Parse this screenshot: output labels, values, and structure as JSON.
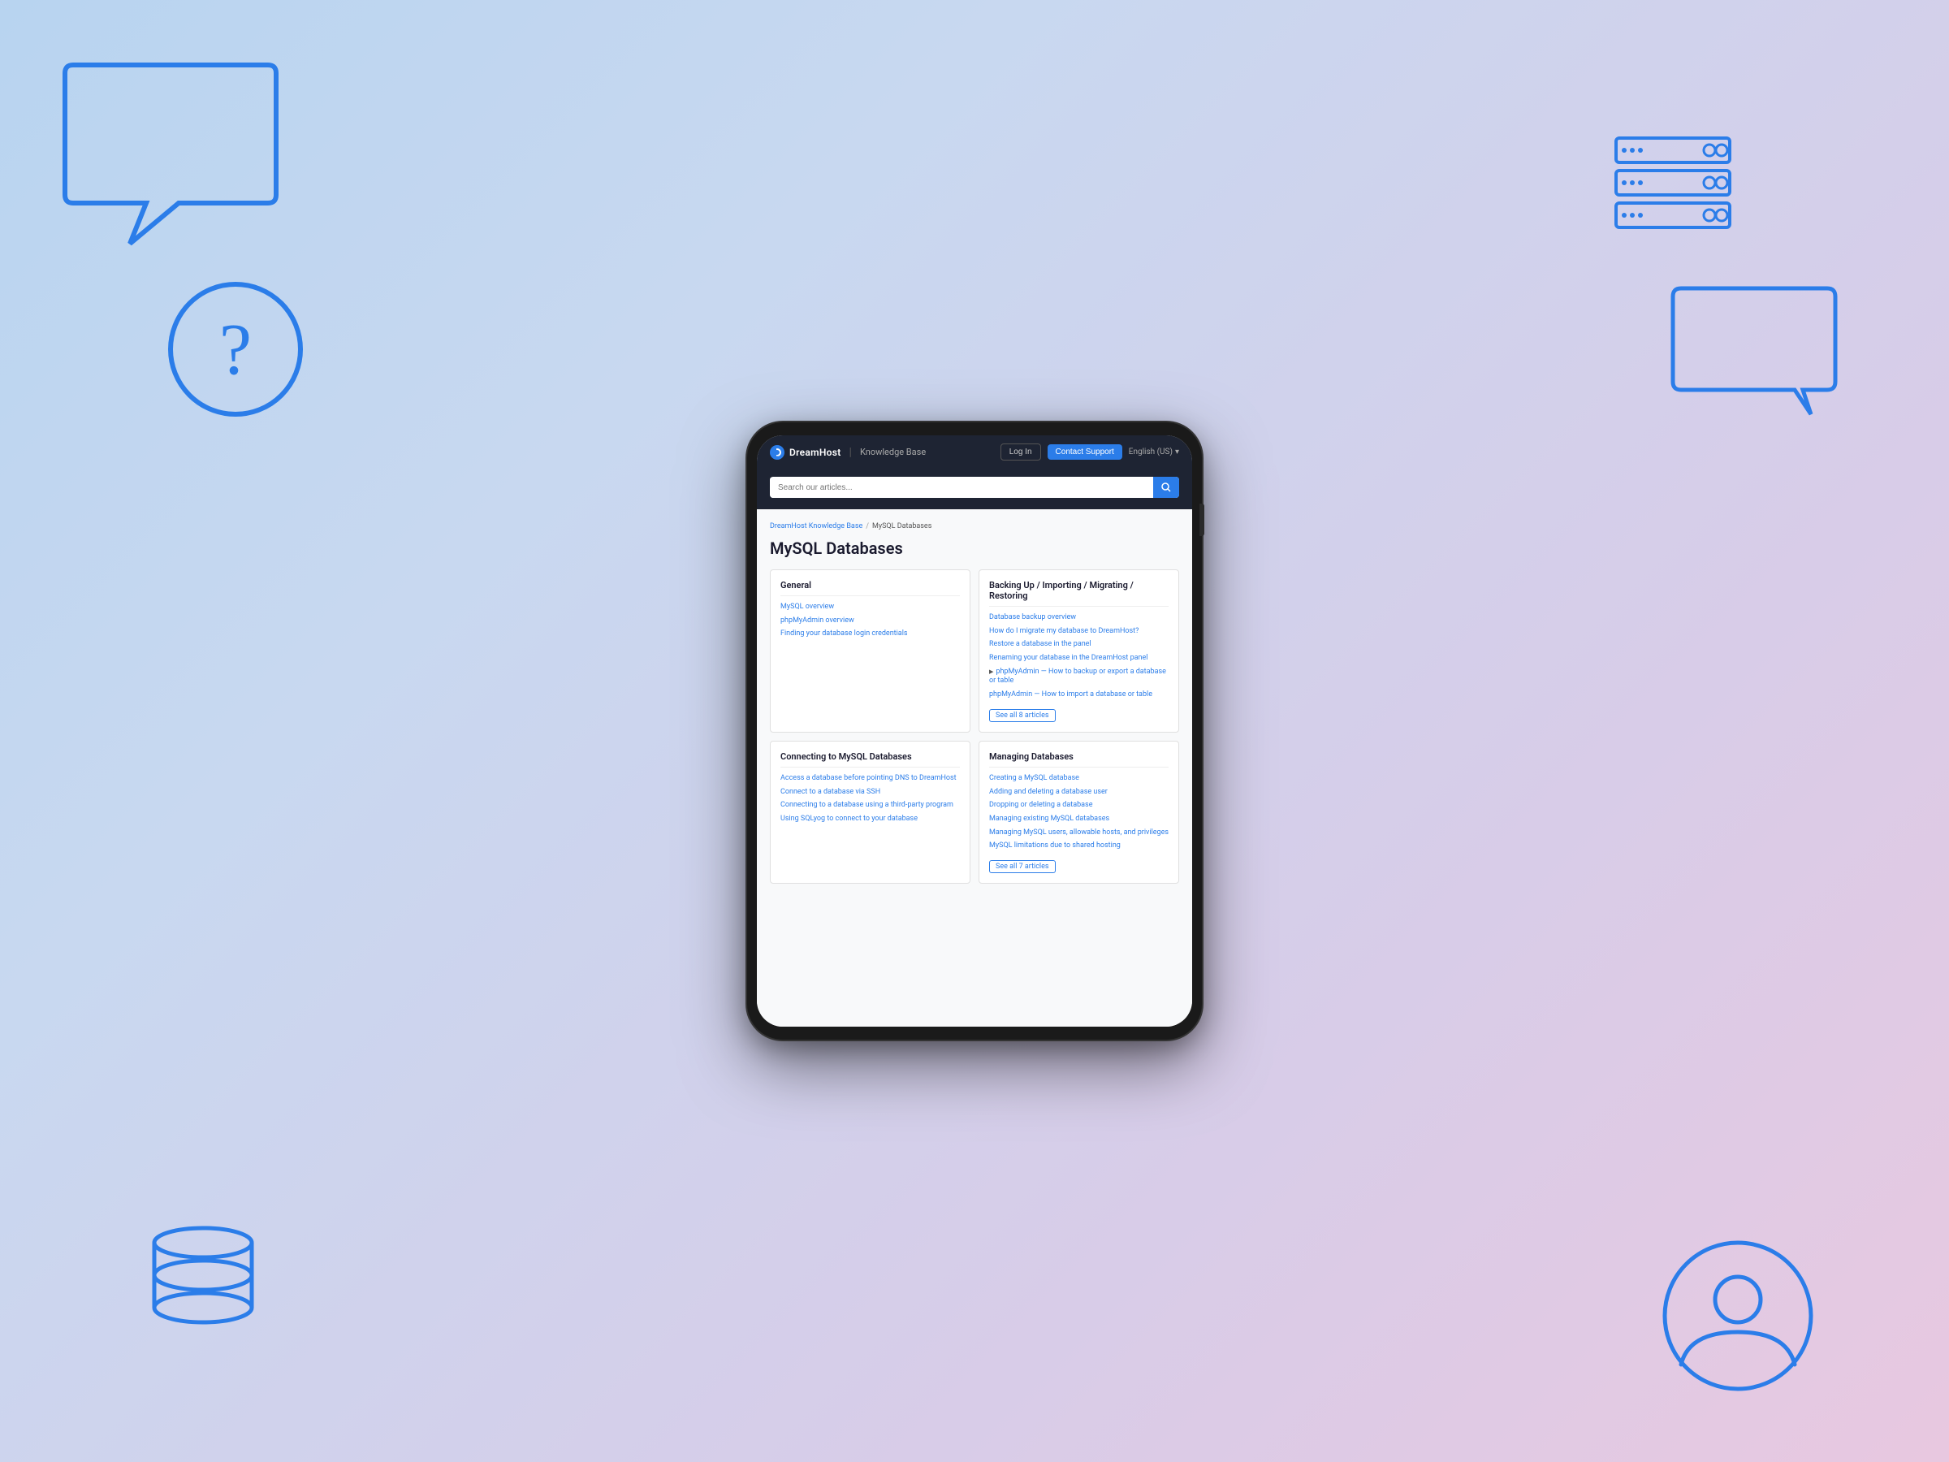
{
  "background": {
    "gradient_start": "#b8d4f0",
    "gradient_end": "#e8c8e0"
  },
  "nav": {
    "logo_text": "DreamHost",
    "kb_label": "Knowledge Base",
    "login_label": "Log In",
    "contact_label": "Contact Support",
    "lang_label": "English (US)"
  },
  "search": {
    "placeholder": "Search our articles..."
  },
  "breadcrumb": {
    "home": "DreamHost Knowledge Base",
    "separator": "/",
    "current": "MySQL Databases"
  },
  "page_title": "MySQL Databases",
  "cards": [
    {
      "id": "general",
      "title": "General",
      "links": [
        {
          "text": "MySQL overview",
          "has_icon": false
        },
        {
          "text": "phpMyAdmin overview",
          "has_icon": false
        },
        {
          "text": "Finding your database login credentials",
          "has_icon": false
        }
      ],
      "see_all": null
    },
    {
      "id": "backing-up",
      "title": "Backing Up / Importing / Migrating / Restoring",
      "links": [
        {
          "text": "Database backup overview",
          "has_icon": false
        },
        {
          "text": "How do I migrate my database to DreamHost?",
          "has_icon": false
        },
        {
          "text": "Restore a database in the panel",
          "has_icon": false
        },
        {
          "text": "Renaming your database in the DreamHost panel",
          "has_icon": false
        },
        {
          "text": "phpMyAdmin — How to backup or export a database or table",
          "has_icon": true
        },
        {
          "text": "phpMyAdmin — How to import a database or table",
          "has_icon": false
        }
      ],
      "see_all": "See all 8 articles"
    },
    {
      "id": "connecting",
      "title": "Connecting to MySQL Databases",
      "links": [
        {
          "text": "Access a database before pointing DNS to DreamHost",
          "has_icon": false
        },
        {
          "text": "Connect to a database via SSH",
          "has_icon": false
        },
        {
          "text": "Connecting to a database using a third-party program",
          "has_icon": false
        },
        {
          "text": "Using SQLyog to connect to your database",
          "has_icon": false
        }
      ],
      "see_all": null
    },
    {
      "id": "managing",
      "title": "Managing Databases",
      "links": [
        {
          "text": "Creating a MySQL database",
          "has_icon": false
        },
        {
          "text": "Adding and deleting a database user",
          "has_icon": false
        },
        {
          "text": "Dropping or deleting a database",
          "has_icon": false
        },
        {
          "text": "Managing existing MySQL databases",
          "has_icon": false
        },
        {
          "text": "Managing MySQL users, allowable hosts, and privileges",
          "has_icon": false
        },
        {
          "text": "MySQL limitations due to shared hosting",
          "has_icon": false
        }
      ],
      "see_all": "See all 7 articles"
    }
  ]
}
